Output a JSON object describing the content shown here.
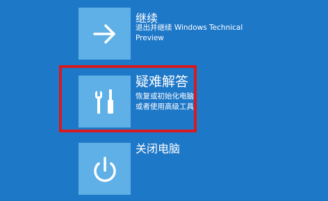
{
  "options": {
    "continue": {
      "title": "继续",
      "description": "退出并继续 Windows Technical Preview",
      "icon": "arrow-right-icon"
    },
    "troubleshoot": {
      "title": "疑难解答",
      "description_line1": "恢复或初始化电脑",
      "description_line2": "或者使用高级工具",
      "icon": "tools-icon"
    },
    "shutdown": {
      "title": "关闭电脑",
      "icon": "power-icon"
    }
  },
  "colors": {
    "background": "#1e78c8",
    "tile": "#5fb0e6",
    "highlight": "#d71920"
  }
}
